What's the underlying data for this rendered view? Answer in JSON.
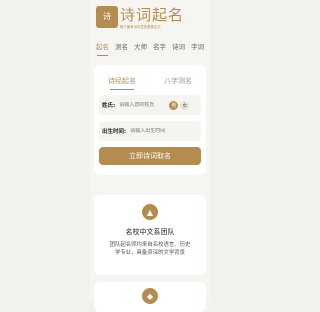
{
  "header": {
    "logo_seal": "诗",
    "title": "诗词起名",
    "subtitle": "取个最有诗句意的美美名字"
  },
  "nav": {
    "items": [
      "起名",
      "测名",
      "大师",
      "名字",
      "诗词",
      "字词"
    ],
    "active_index": 0
  },
  "form": {
    "tabs": [
      "诗经起名",
      "八字测名"
    ],
    "active_tab": 0,
    "surname_label": "姓氏:",
    "surname_placeholder": "请输入您的姓氏",
    "gender_male": "男",
    "gender_female": "女",
    "birth_label": "出生时间:",
    "birth_placeholder": "请输入出生时间",
    "submit_label": "立即诗词取名"
  },
  "feature": {
    "icon": "school-icon",
    "title": "名校中文系团队",
    "description": "团队起名师均来自名校语言、历史学专业，具备资深的文学背景"
  },
  "feature2": {
    "icon": "badge-icon"
  },
  "colors": {
    "accent": "#b58c4f",
    "background": "#f3f1ee",
    "card": "#ffffff"
  }
}
